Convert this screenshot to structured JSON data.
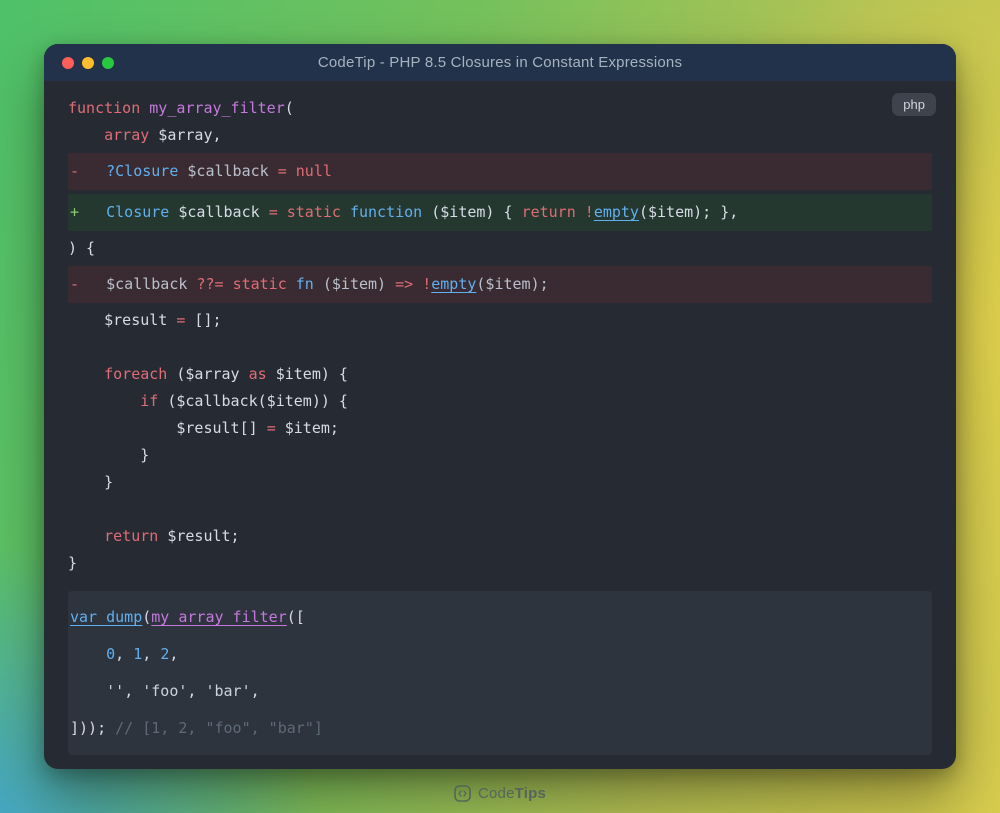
{
  "colors": {
    "kw": "#e06c75",
    "ty": "#61afef",
    "fn": "#c678dd",
    "pl": "#d6dbe4",
    "mut": "#b9c0cb",
    "num": "#61afef",
    "str": "#ccd3dd",
    "cm": "#5e6a78",
    "add-sign": "#8cc973",
    "del-bg": "#392b31",
    "add-bg": "#24382f",
    "block-bg": "#2d343e",
    "titlebar": "#22324a",
    "window": "#262b33",
    "light-red": "#ff5f57",
    "light-yellow": "#febc2e",
    "light-green": "#28c840"
  },
  "window": {
    "title": "CodeTip - PHP 8.5 Closures in Constant Expressions",
    "language_badge": "php"
  },
  "code": {
    "main_lines": [
      {
        "tokens": [
          [
            "function ",
            "kw"
          ],
          [
            "my_array_filter",
            "fn"
          ],
          [
            "(",
            "pl"
          ]
        ]
      },
      {
        "tokens": [
          [
            "    ",
            "pl"
          ],
          [
            "array",
            "kw"
          ],
          [
            " $array,",
            "pl"
          ]
        ]
      },
      {
        "diff": "del",
        "sign": "-",
        "tokens": [
          [
            "   ",
            "pl"
          ],
          [
            "?Closure",
            "ty"
          ],
          [
            " $callback ",
            "mut"
          ],
          [
            "= null",
            "kw"
          ]
        ]
      },
      {
        "diff": "add",
        "sign": "+",
        "tokens": [
          [
            "   ",
            "pl"
          ],
          [
            "Closure",
            "ty"
          ],
          [
            " $callback ",
            "pl"
          ],
          [
            "= static ",
            "kw"
          ],
          [
            "function",
            "ty"
          ],
          [
            " ($item) { ",
            "pl"
          ],
          [
            "return ",
            "kw"
          ],
          [
            "!",
            "kw"
          ],
          [
            "empty",
            "tyu"
          ],
          [
            "($item); },",
            "pl"
          ]
        ]
      },
      {
        "tokens": [
          [
            ") {",
            "pl"
          ]
        ]
      },
      {
        "diff": "del",
        "sign": "-",
        "tokens": [
          [
            "   ",
            "pl"
          ],
          [
            "$callback ",
            "mut"
          ],
          [
            "??= ",
            "kw"
          ],
          [
            "static ",
            "kw"
          ],
          [
            "fn",
            "ty"
          ],
          [
            " ($item) ",
            "mut"
          ],
          [
            "=> ",
            "kw"
          ],
          [
            "!",
            "kw"
          ],
          [
            "empty",
            "tyu"
          ],
          [
            "($item);",
            "mut"
          ]
        ]
      },
      {
        "tokens": [
          [
            "    $result ",
            "pl"
          ],
          [
            "=",
            "kw"
          ],
          [
            " [];",
            "pl"
          ]
        ]
      },
      {
        "blank": true
      },
      {
        "tokens": [
          [
            "    ",
            "pl"
          ],
          [
            "foreach",
            "kw"
          ],
          [
            " ($array ",
            "pl"
          ],
          [
            "as",
            "kw"
          ],
          [
            " $item) {",
            "pl"
          ]
        ]
      },
      {
        "tokens": [
          [
            "        ",
            "pl"
          ],
          [
            "if",
            "kw"
          ],
          [
            " ($callback($item)) {",
            "pl"
          ]
        ]
      },
      {
        "tokens": [
          [
            "            $result[] ",
            "pl"
          ],
          [
            "=",
            "kw"
          ],
          [
            " $item;",
            "pl"
          ]
        ]
      },
      {
        "tokens": [
          [
            "        }",
            "pl"
          ]
        ]
      },
      {
        "tokens": [
          [
            "    }",
            "pl"
          ]
        ]
      },
      {
        "blank": true
      },
      {
        "tokens": [
          [
            "    ",
            "pl"
          ],
          [
            "return",
            "kw"
          ],
          [
            " $result;",
            "pl"
          ]
        ]
      },
      {
        "tokens": [
          [
            "}",
            "pl"
          ]
        ]
      }
    ],
    "block_lines": [
      {
        "tokens": [
          [
            "var_dump",
            "tyu"
          ],
          [
            "(",
            "pl"
          ],
          [
            "my_array_filter",
            "fnu"
          ],
          [
            "([",
            "pl"
          ]
        ]
      },
      {
        "tokens": [
          [
            "    ",
            "pl"
          ],
          [
            "0",
            "num"
          ],
          [
            ", ",
            "pl"
          ],
          [
            "1",
            "num"
          ],
          [
            ", ",
            "pl"
          ],
          [
            "2",
            "num"
          ],
          [
            ",",
            "pl"
          ]
        ]
      },
      {
        "tokens": [
          [
            "    ",
            "pl"
          ],
          [
            "''",
            "str"
          ],
          [
            ", ",
            "pl"
          ],
          [
            "'foo'",
            "str"
          ],
          [
            ", ",
            "pl"
          ],
          [
            "'bar'",
            "str"
          ],
          [
            ",",
            "pl"
          ]
        ]
      },
      {
        "tokens": [
          [
            "])); ",
            "pl"
          ],
          [
            "// [1, 2, \"foo\", \"bar\"]",
            "cm"
          ]
        ]
      }
    ]
  },
  "footer": {
    "brand_code": "Code",
    "brand_tips": "Tips"
  }
}
